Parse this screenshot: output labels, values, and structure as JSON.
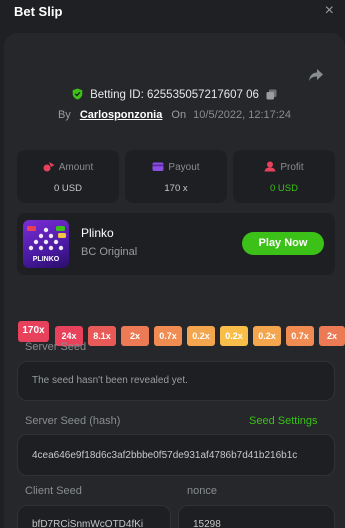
{
  "header": {
    "title": "Bet Slip",
    "close_glyph": "×"
  },
  "bet": {
    "id_text": "Betting ID: 625535057217607 06",
    "by_label": "By",
    "username": "Carlosponzonia",
    "on_label": "On",
    "date": "10/5/2022, 12:17:24"
  },
  "stats": [
    {
      "label": "Amount",
      "value": "0 USD",
      "icon": "amount-icon",
      "color": "#e8415c"
    },
    {
      "label": "Payout",
      "value": "170 x",
      "icon": "payout-icon",
      "color": "#8b4de4"
    },
    {
      "label": "Profit",
      "value": "0 USD",
      "icon": "profit-icon",
      "color": "#e8415c"
    }
  ],
  "game": {
    "name": "Plinko",
    "subtitle": "BC Original",
    "thumb_text": "PLINKO",
    "play_label": "Play Now"
  },
  "multipliers": [
    {
      "label": "170x",
      "color": "#e8415c"
    },
    {
      "label": "24x",
      "color": "#e8415c"
    },
    {
      "label": "8.1x",
      "color": "#e85a58"
    },
    {
      "label": "2x",
      "color": "#ec7a55"
    },
    {
      "label": "0.7x",
      "color": "#f08c52"
    },
    {
      "label": "0.2x",
      "color": "#f4a64e"
    },
    {
      "label": "0.2x",
      "color": "#f8be4a"
    },
    {
      "label": "0.2x",
      "color": "#f4a64e"
    },
    {
      "label": "0.7x",
      "color": "#f08c52"
    },
    {
      "label": "2x",
      "color": "#ec7a55"
    }
  ],
  "seeds": {
    "server_seed_label": "Server Seed",
    "server_seed_value": "The seed hasn't been revealed yet.",
    "server_hash_label": "Server Seed (hash)",
    "seed_settings_label": "Seed Settings",
    "server_hash_value": "4cea646e9f18d6c3af2bbbe0f57de931af4786b7d41b216b1c",
    "client_seed_label": "Client Seed",
    "client_seed_value": "bfD7RCiSnmWcOTD4fKi",
    "nonce_label": "nonce",
    "nonce_value": "15298"
  },
  "colors": {
    "accent_green": "#3bc117",
    "panel": "#25272b",
    "card": "#1d1f22"
  }
}
